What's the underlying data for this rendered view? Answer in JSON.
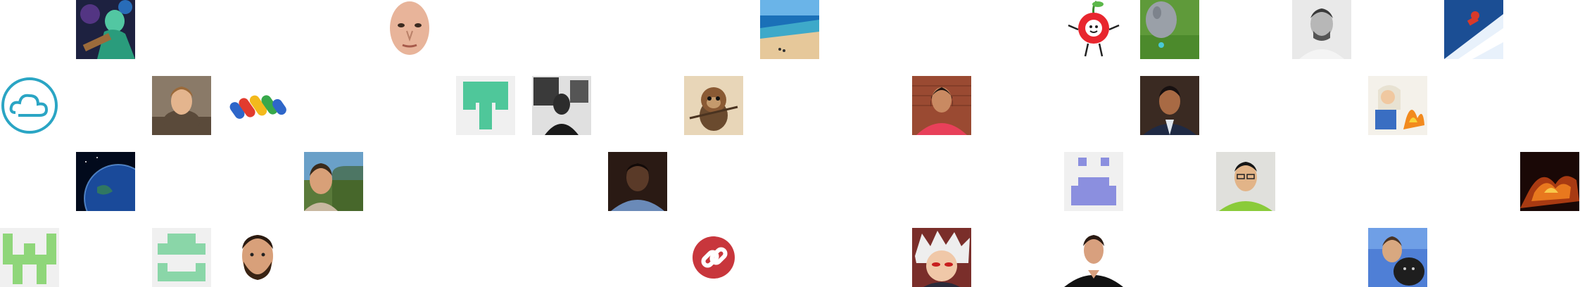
{
  "grid": {
    "columns": 21,
    "rows": 4,
    "avatars": [
      {
        "col": 1,
        "row": 0,
        "kind": "photo-concert-guitarist"
      },
      {
        "col": 5,
        "row": 0,
        "kind": "photo-bald-face"
      },
      {
        "col": 10,
        "row": 0,
        "kind": "photo-beach"
      },
      {
        "col": 14,
        "row": 0,
        "kind": "cartoon-cherry"
      },
      {
        "col": 15,
        "row": 0,
        "kind": "photo-goat-grass"
      },
      {
        "col": 17,
        "row": 0,
        "kind": "photo-man-bw"
      },
      {
        "col": 19,
        "row": 0,
        "kind": "photo-snowboarder"
      },
      {
        "col": 0,
        "row": 1,
        "kind": "logo-cloud"
      },
      {
        "col": 2,
        "row": 1,
        "kind": "photo-curly-hair-man"
      },
      {
        "col": 3,
        "row": 1,
        "kind": "logo-wallet-stripes"
      },
      {
        "col": 6,
        "row": 1,
        "kind": "identicon-green"
      },
      {
        "col": 7,
        "row": 1,
        "kind": "photo-dark-gallery"
      },
      {
        "col": 9,
        "row": 1,
        "kind": "photo-ewok"
      },
      {
        "col": 12,
        "row": 1,
        "kind": "photo-woman-brick"
      },
      {
        "col": 15,
        "row": 1,
        "kind": "photo-man-suit"
      },
      {
        "col": 18,
        "row": 1,
        "kind": "comic-asterix"
      },
      {
        "col": 1,
        "row": 2,
        "kind": "photo-earth-space"
      },
      {
        "col": 4,
        "row": 2,
        "kind": "photo-man-outdoors"
      },
      {
        "col": 8,
        "row": 2,
        "kind": "photo-man-dark"
      },
      {
        "col": 14,
        "row": 2,
        "kind": "identicon-purple"
      },
      {
        "col": 16,
        "row": 2,
        "kind": "photo-man-glasses-green"
      },
      {
        "col": 20,
        "row": 2,
        "kind": "photo-fire-art"
      },
      {
        "col": 0,
        "row": 3,
        "kind": "identicon-green-2"
      },
      {
        "col": 2,
        "row": 3,
        "kind": "identicon-green-3"
      },
      {
        "col": 3,
        "row": 3,
        "kind": "photo-bearded-face"
      },
      {
        "col": 9,
        "row": 3,
        "kind": "logo-link-red"
      },
      {
        "col": 12,
        "row": 3,
        "kind": "anime-white-hair"
      },
      {
        "col": 14,
        "row": 3,
        "kind": "photo-man-black-shirt"
      },
      {
        "col": 18,
        "row": 3,
        "kind": "photo-selfie-dog"
      }
    ]
  }
}
